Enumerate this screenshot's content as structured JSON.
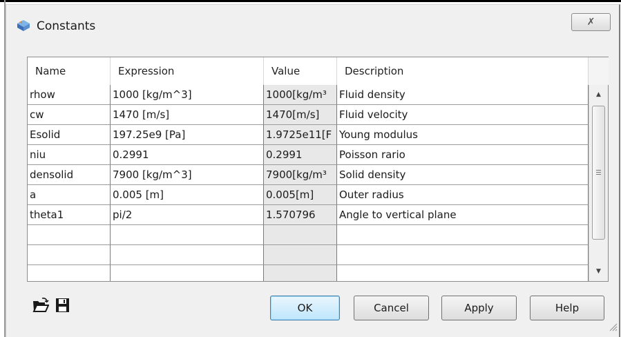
{
  "window": {
    "title": "Constants",
    "close_symbol": "✗"
  },
  "table": {
    "columns": [
      "Name",
      "Expression",
      "Value",
      "Description"
    ],
    "rows": [
      {
        "name": "rhow",
        "expression": "1000 [kg/m^3]",
        "value": "1000[kg/m³",
        "description": "Fluid density"
      },
      {
        "name": "cw",
        "expression": "1470 [m/s]",
        "value": "1470[m/s]",
        "description": "Fluid velocity"
      },
      {
        "name": "Esolid",
        "expression": "197.25e9 [Pa]",
        "value": "1.9725e11[F",
        "description": "Young modulus"
      },
      {
        "name": "niu",
        "expression": "0.2991",
        "value": "0.2991",
        "description": "Poisson rario"
      },
      {
        "name": "densolid",
        "expression": "7900 [kg/m^3]",
        "value": "7900[kg/m³",
        "description": "Solid density"
      },
      {
        "name": "a",
        "expression": "0.005 [m]",
        "value": "0.005[m]",
        "description": "Outer radius"
      },
      {
        "name": "theta1",
        "expression": "pi/2",
        "value": "1.570796",
        "description": "Angle to vertical plane"
      },
      {
        "name": "",
        "expression": "",
        "value": "",
        "description": ""
      },
      {
        "name": "",
        "expression": "",
        "value": "",
        "description": ""
      },
      {
        "name": "",
        "expression": "",
        "value": "",
        "description": ""
      }
    ]
  },
  "scrollbar": {
    "up_symbol": "▲",
    "down_symbol": "▼"
  },
  "buttons": {
    "ok": "OK",
    "cancel": "Cancel",
    "apply": "Apply",
    "help": "Help"
  },
  "icons": {
    "app": "constants-app-icon",
    "open": "open-folder-icon",
    "save": "save-disk-icon"
  }
}
